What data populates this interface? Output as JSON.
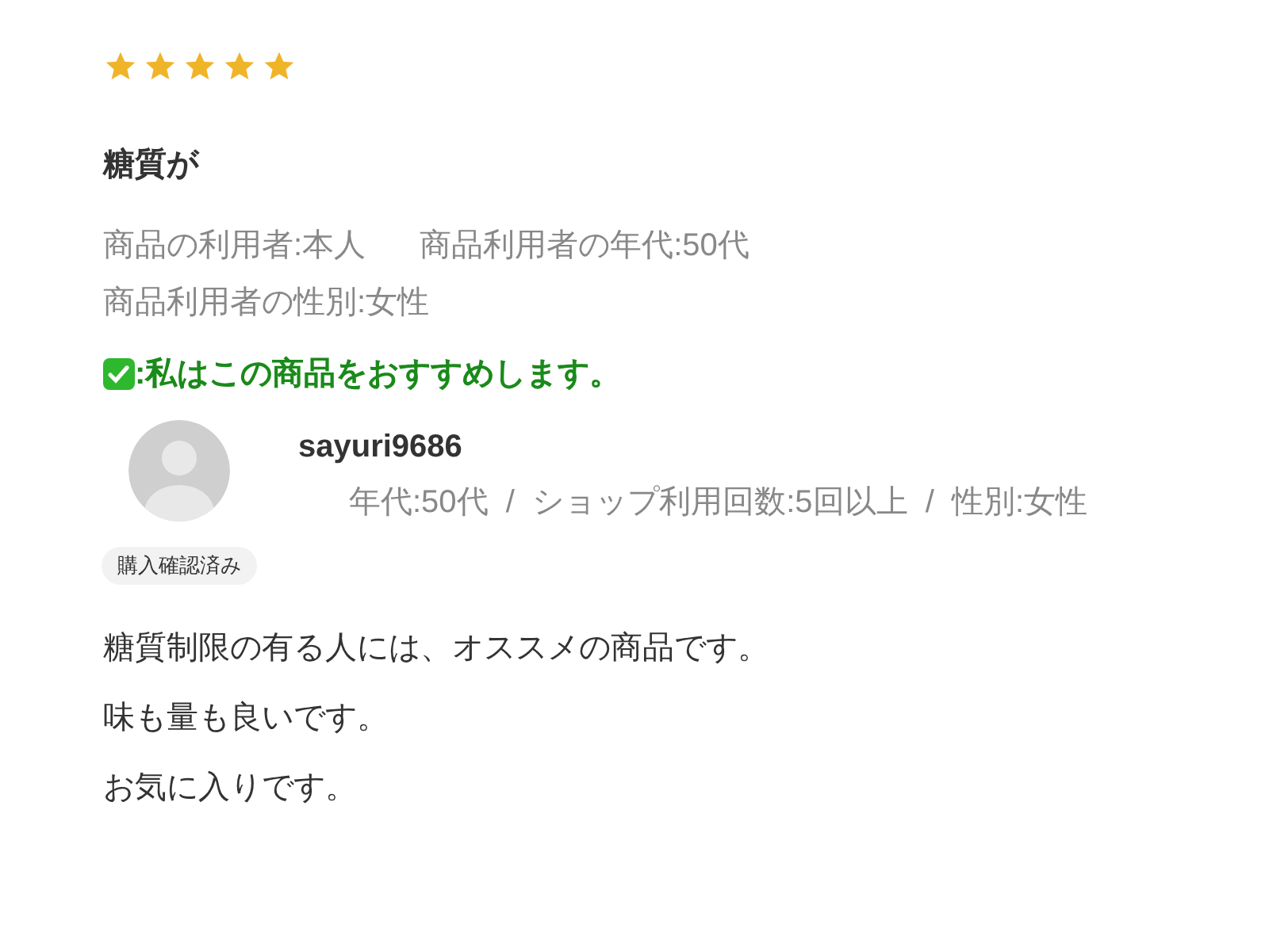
{
  "review": {
    "stars": 5,
    "title": "糖質が",
    "attributes": [
      "商品の利用者:本人",
      "商品利用者の年代:50代",
      "商品利用者の性別:女性"
    ],
    "recommend": {
      "checked": true,
      "text": ":私はこの商品をおすすめします。"
    },
    "reviewer": {
      "name": "sayuri9686",
      "badge": "購入確認済み",
      "meta": "年代:50代  /  ショップ利用回数:5回以上  /  性別:女性"
    },
    "body": [
      "糖質制限の有る人には、オススメの商品です。",
      "味も量も良いです。",
      "お気に入りです。"
    ]
  }
}
